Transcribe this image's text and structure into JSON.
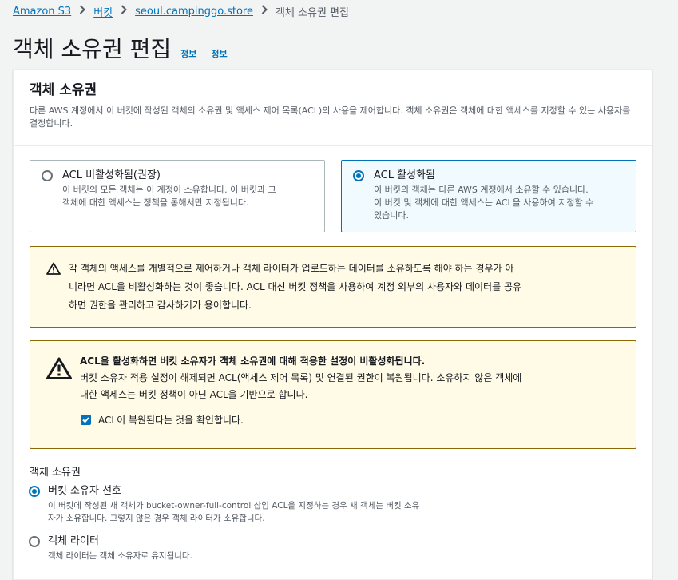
{
  "breadcrumb": {
    "items": [
      "Amazon S3",
      "버킷",
      "seoul.campinggo.store"
    ],
    "current": "객체 소유권 편집"
  },
  "page": {
    "title": "객체 소유권 편집",
    "info_links": [
      "정보",
      "정보"
    ]
  },
  "panel": {
    "title": "객체 소유권",
    "description": "다른 AWS 계정에서 이 버킷에 작성된 객체의 소유권 및 액세스 제어 목록(ACL)의 사용을 제어합니다. 객체 소유권은 객체에 대한 액세스를 지정할 수 있는 사용자를 결정합니다."
  },
  "acl_tiles": [
    {
      "label": "ACL 비활성화됨(권장)",
      "desc_lines": [
        "이 버킷의 모든 객체는 이 계정이 소유합니다. 이 버킷과 그",
        "객체에 대한 액세스는 정책을 통해서만 지정됩니다."
      ],
      "selected": false
    },
    {
      "label": "ACL 활성화됨",
      "desc_lines": [
        "이 버킷의 객체는 다른 AWS 계정에서 소유할 수 있습니다.",
        "이 버킷 및 객체에 대한 액세스는 ACL을 사용하여 지정할 수",
        "있습니다."
      ],
      "selected": true
    }
  ],
  "alert_recommend": {
    "lines": [
      "각 객체의 액세스를 개별적으로 제어하거나 객체 라이터가 업로드하는 데이터를 소유하도록 해야 하는 경우가 아",
      "니라면 ACL을 비활성화하는 것이 좋습니다. ACL 대신 버킷 정책을 사용하여 계정 외부의 사용자와 데이터를 공유",
      "하면 권한을 관리하고 감사하기가 용이합니다."
    ]
  },
  "alert_warning": {
    "title": "ACL을 활성화하면 버킷 소유자가 객체 소유권에 대해 적용한 설정이 비활성화됩니다.",
    "body_lines": [
      "버킷 소유자 적용 설정이 해제되면 ACL(액세스 제어 목록) 및 연결된 권한이 복원됩니다. 소유하지 않은 객체에",
      "대한 액세스는 버킷 정책이 아닌 ACL을 기반으로 합니다."
    ],
    "checkbox_label": "ACL이 복원된다는 것을 확인합니다.",
    "checkbox_checked": true
  },
  "ownership": {
    "label": "객체 소유권",
    "options": [
      {
        "label": "버킷 소유자 선호",
        "desc_lines": [
          "이 버킷에 작성된 새 객체가 bucket-owner-full-control 삽입 ACL을 지정하는 경우 새 객체는 버킷 소유",
          "자가 소유합니다. 그렇지 않은 경우 객체 라이터가 소유합니다."
        ],
        "selected": true
      },
      {
        "label": "객체 라이터",
        "desc_lines": [
          "객체 라이터는 객체 소유자로 유지됩니다."
        ],
        "selected": false
      }
    ]
  },
  "colors": {
    "link": "#0073bb",
    "warning_border": "#8d6605",
    "warning_bg": "#fffbe6"
  }
}
